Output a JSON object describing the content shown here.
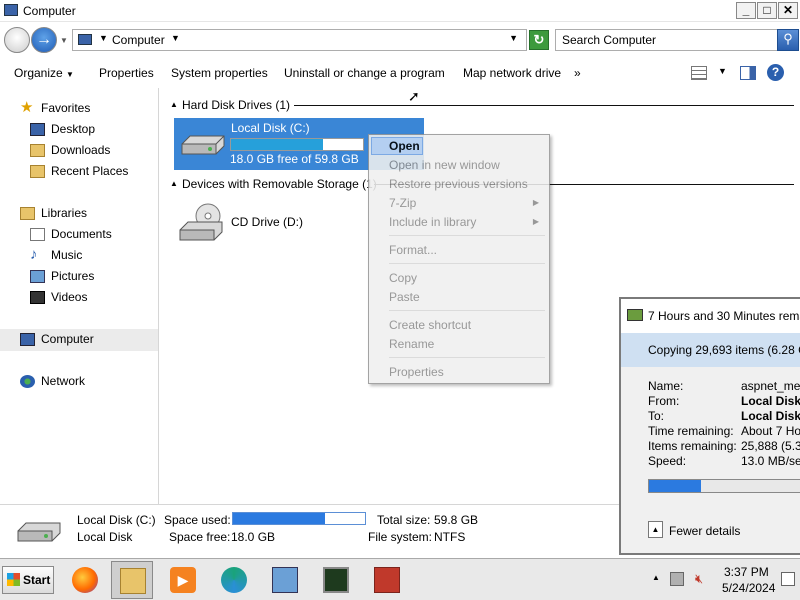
{
  "window": {
    "title": "Computer"
  },
  "address": {
    "crumb": "Computer",
    "search_placeholder": "Search Computer"
  },
  "toolbar": {
    "organize": "Organize",
    "properties": "Properties",
    "system_properties": "System properties",
    "uninstall": "Uninstall or change a program",
    "map_drive": "Map network drive",
    "more": "»"
  },
  "nav": {
    "favorites": "Favorites",
    "desktop": "Desktop",
    "downloads": "Downloads",
    "recent": "Recent Places",
    "libraries": "Libraries",
    "documents": "Documents",
    "music": "Music",
    "pictures": "Pictures",
    "videos": "Videos",
    "computer": "Computer",
    "network": "Network"
  },
  "content": {
    "hdd_group": "Hard Disk Drives (1)",
    "removable_group": "Devices with Removable Storage (1)",
    "local_disk": {
      "name": "Local Disk (C:)",
      "free_text": "18.0 GB free of 59.8 GB",
      "used_fraction": 0.7
    },
    "cd_drive": {
      "name": "CD Drive (D:)"
    }
  },
  "context_menu": {
    "open": "Open",
    "open_new_window": "Open in new window",
    "restore": "Restore previous versions",
    "zip": "7-Zip",
    "include": "Include in library",
    "format": "Format...",
    "copy": "Copy",
    "paste": "Paste",
    "create_shortcut": "Create shortcut",
    "rename": "Rename",
    "properties": "Properties"
  },
  "details": {
    "name": "Local Disk (C:)",
    "type": "Local Disk",
    "space_used_label": "Space used:",
    "space_free_label": "Space free:",
    "space_free": "18.0 GB",
    "total_label": "Total size:",
    "total": "59.8 GB",
    "fs_label": "File system:",
    "fs": "NTFS",
    "used_fraction": 0.7
  },
  "copy_dialog": {
    "title": "7 Hours and 30 Minutes rema",
    "heading": "Copying 29,693 items (6.28 G",
    "rows": [
      {
        "key": "Name:",
        "value": "aspnet_mer",
        "bold": false
      },
      {
        "key": "From:",
        "value": "Local Disk (",
        "bold": true
      },
      {
        "key": "To:",
        "value": "Local Disk (",
        "bold": true
      },
      {
        "key": "Time remaining:",
        "value": "About 7 Ho",
        "bold": false
      },
      {
        "key": "Items remaining:",
        "value": "25,888 (5.33",
        "bold": false
      },
      {
        "key": "Speed:",
        "value": "13.0 MB/sec",
        "bold": false
      }
    ],
    "progress_fraction": 0.33,
    "fewer_details": "Fewer details"
  },
  "taskbar": {
    "start": "Start",
    "time": "3:37 PM",
    "date": "5/24/2024"
  },
  "colors": {
    "selection": "#3a86d6",
    "accent": "#2b7ae0",
    "menu_bg": "#f0f0f0"
  },
  "icons": [
    "computer-icon",
    "back-icon",
    "forward-icon",
    "refresh-icon",
    "search-icon",
    "star-icon",
    "folder-icon",
    "hard-disk-icon",
    "cd-drive-icon",
    "network-icon",
    "help-icon",
    "start-flag-icon",
    "firefox-icon",
    "explorer-icon",
    "media-player-icon",
    "edge-icon",
    "control-panel-icon",
    "task-manager-icon",
    "toolbox-icon"
  ]
}
